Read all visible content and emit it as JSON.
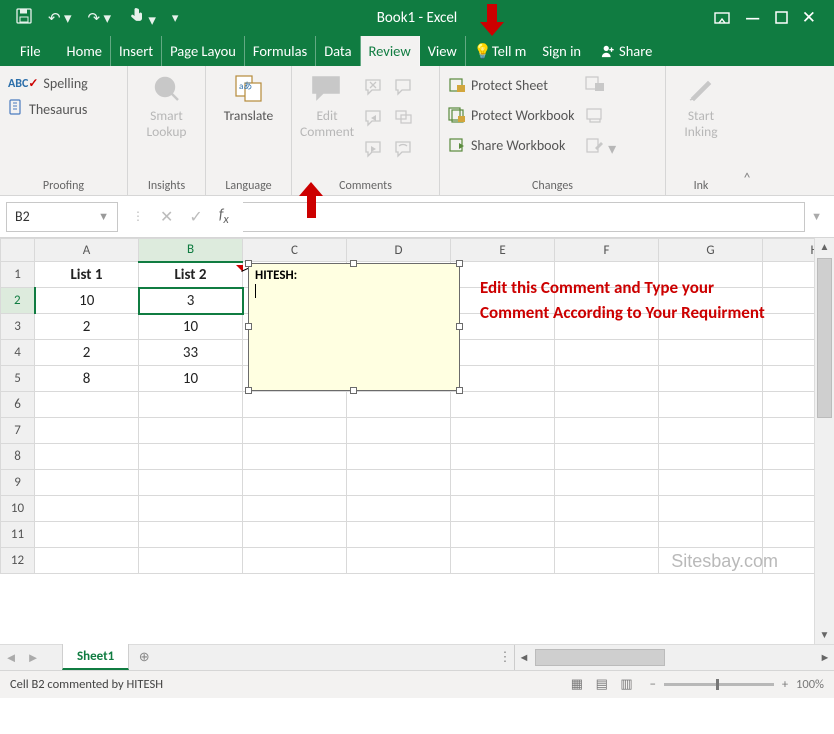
{
  "app": {
    "title": "Book1 - Excel"
  },
  "titlebar_icons": {
    "save": "save-icon",
    "undo": "undo-icon",
    "redo": "redo-icon",
    "touch": "touch-icon",
    "more": "more-icon"
  },
  "tabs": {
    "file": "File",
    "home": "Home",
    "insert": "Insert",
    "pagelayout": "Page Layou",
    "formulas": "Formulas",
    "data": "Data",
    "review": "Review",
    "view": "View",
    "tellme": "Tell m",
    "signin": "Sign in",
    "share": "Share"
  },
  "ribbon": {
    "proofing": {
      "label": "Proofing",
      "spelling": "Spelling",
      "thesaurus": "Thesaurus"
    },
    "insights": {
      "label": "Insights",
      "smart": "Smart",
      "lookup": "Lookup"
    },
    "language": {
      "label": "Language",
      "translate": "Translate"
    },
    "comments": {
      "label": "Comments",
      "edit": "Edit",
      "comment": "Comment"
    },
    "changes": {
      "label": "Changes",
      "protect_sheet": "Protect Sheet",
      "protect_workbook": "Protect Workbook",
      "share_workbook": "Share Workbook"
    },
    "ink": {
      "label": "Ink",
      "start": "Start",
      "inking": "Inking"
    }
  },
  "namebox": {
    "ref": "B2"
  },
  "formula": {
    "value": ""
  },
  "columns": [
    "A",
    "B",
    "C",
    "D",
    "E",
    "F",
    "G",
    "H"
  ],
  "rows": [
    "1",
    "2",
    "3",
    "4",
    "5",
    "6",
    "7",
    "8",
    "9",
    "10",
    "11",
    "12"
  ],
  "data": {
    "headers": [
      "List 1",
      "List 2"
    ],
    "r2": [
      "10",
      "3"
    ],
    "r3": [
      "2",
      "10"
    ],
    "r4": [
      "2",
      "33"
    ],
    "r5": [
      "8",
      "10"
    ]
  },
  "comment": {
    "author": "HITESH:",
    "body": ""
  },
  "annotation": "Edit this Comment and Type your Comment According to Your Requirment",
  "watermark": "Sitesbay.com",
  "sheet_tabs": {
    "sheet1": "Sheet1"
  },
  "status": {
    "message": "Cell B2 commented by HITESH",
    "zoom": "100%"
  }
}
